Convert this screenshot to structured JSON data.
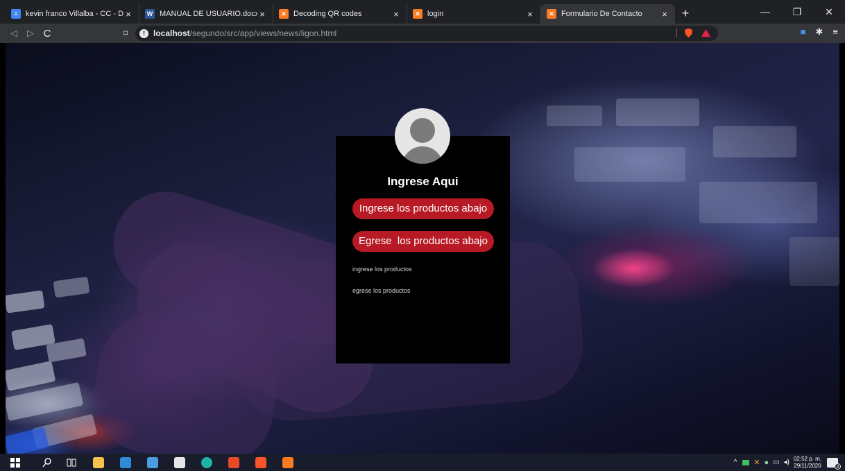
{
  "browser": {
    "tabs": [
      {
        "title": "kevin franco Villalba - CC - Docum",
        "favicon": "google-docs-icon",
        "color": "#4285f4",
        "active": false
      },
      {
        "title": "MANUAL DE USUARIO.docx",
        "favicon": "word-icon",
        "color": "#2b579a",
        "active": false
      },
      {
        "title": "Decoding QR codes",
        "favicon": "xampp-icon",
        "color": "#fb7a24",
        "active": false
      },
      {
        "title": "login",
        "favicon": "xampp-icon",
        "color": "#fb7a24",
        "active": false
      },
      {
        "title": "Formulario De Contacto",
        "favicon": "xampp-icon",
        "color": "#fb7a24",
        "active": true
      }
    ],
    "new_tab": "+",
    "address": {
      "host": "localhost",
      "path": "/segundo/src/app/views/news/ligon.html"
    }
  },
  "login": {
    "title": "Ingrese Aqui",
    "button_in": "Ingrese los productos abajo",
    "button_out": "Egrese  los productos abajo",
    "link_in": "ingrese los productos",
    "link_out": "egrese los productos",
    "accent_color": "#b81a25"
  },
  "taskbar": {
    "time": "02:52 p. m.",
    "date": "29/11/2020",
    "notifications": "4"
  }
}
